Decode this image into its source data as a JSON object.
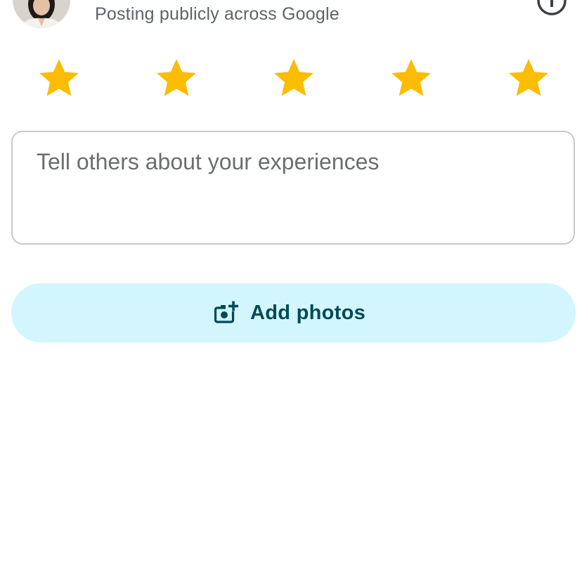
{
  "header": {
    "posting_note": "Posting publicly across Google",
    "avatar_icon": "user-avatar",
    "info_icon": "info-icon"
  },
  "rating": {
    "stars_filled": 5,
    "stars_total": 5,
    "star_color": "#FBBC04",
    "star_icon": "star-icon"
  },
  "review": {
    "placeholder": "Tell others about your experiences",
    "value": ""
  },
  "photos": {
    "label": "Add photos",
    "icon": "add-photo-icon",
    "background_color": "#D3F5FD",
    "text_color": "#004A55"
  }
}
